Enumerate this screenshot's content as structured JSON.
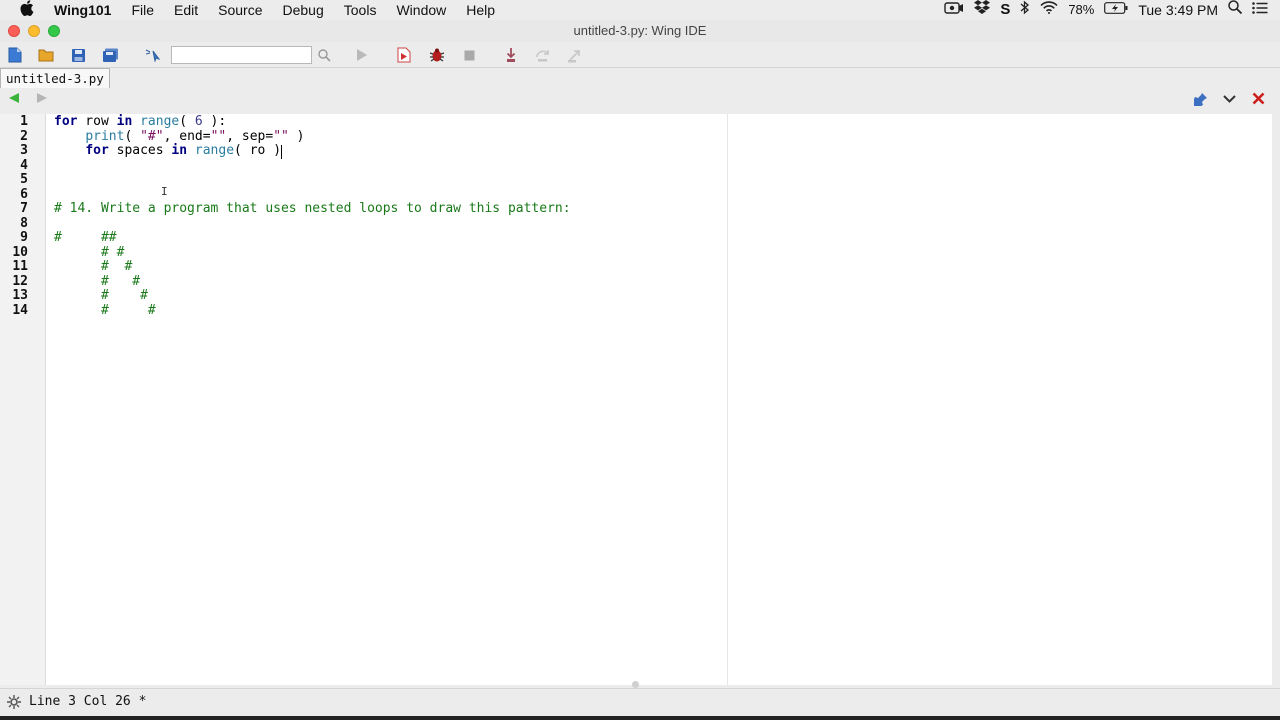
{
  "menubar": {
    "app_name": "Wing101",
    "items": [
      "File",
      "Edit",
      "Source",
      "Debug",
      "Tools",
      "Window",
      "Help"
    ],
    "battery": "78%",
    "clock": "Tue 3:49 PM"
  },
  "window": {
    "title": "untitled-3.py: Wing IDE"
  },
  "editor": {
    "tab_label": "untitled-3.py",
    "line_numbers": [
      "1",
      "2",
      "3",
      "4",
      "5",
      "6",
      "7",
      "8",
      "9",
      "10",
      "11",
      "12",
      "13",
      "14"
    ],
    "lines": {
      "l1": {
        "kw1": "for",
        "t1": " row ",
        "kw2": "in",
        "t2": " ",
        "bi": "range",
        "t3": "( ",
        "num": "6",
        "t4": " ):"
      },
      "l2": {
        "indent": "    ",
        "bi": "print",
        "t1": "( ",
        "s1": "\"#\"",
        "t2": ", end=",
        "s2": "\"\"",
        "t3": ", sep=",
        "s3": "\"\"",
        "t4": " )"
      },
      "l3": {
        "indent": "    ",
        "kw1": "for",
        "t1": " spaces ",
        "kw2": "in",
        "t2": " ",
        "bi": "range",
        "t3": "( ro ",
        "t4": ")"
      },
      "l7": "# 14. Write a program that uses nested loops to draw this pattern:",
      "l9": "#     ##",
      "l10": "      # #",
      "l11": "      #  #",
      "l12": "      #   #",
      "l13": "      #    #",
      "l14": "      #     #"
    }
  },
  "status": {
    "text": "Line 3 Col 26 *"
  },
  "colors": {
    "keyword": "#000080",
    "builtin": "#2a7d9f",
    "comment": "#1a7a1a",
    "string": "#7a1060"
  }
}
